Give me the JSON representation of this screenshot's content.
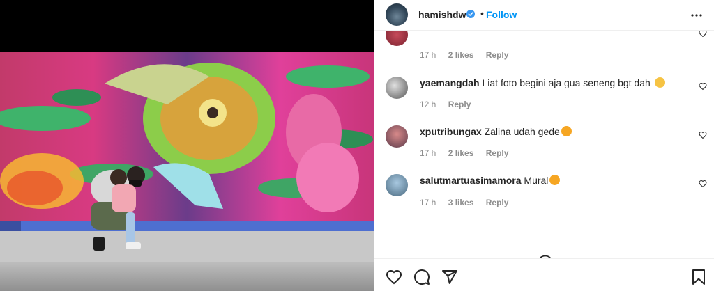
{
  "post": {
    "username": "hamishdw",
    "follow_label": "Follow",
    "separator": "•"
  },
  "comments": [
    {
      "username": "",
      "text": "",
      "time": "17 h",
      "likes": "2 likes",
      "reply": "Reply",
      "emoji_color": "#f6c343"
    },
    {
      "username": "yaemangdah",
      "text": "Liat foto begini aja gua seneng bgt dah",
      "time": "12 h",
      "likes": "",
      "reply": "Reply",
      "emoji_color": "#f6c343"
    },
    {
      "username": "xputribungax",
      "text": "Zalina udah gede",
      "time": "17 h",
      "likes": "2 likes",
      "reply": "Reply",
      "emoji_color": "#f6a623"
    },
    {
      "username": "salutmartuasimamora",
      "text": "Mural",
      "time": "17 h",
      "likes": "3 likes",
      "reply": "Reply",
      "emoji_color": "#f6a623"
    }
  ],
  "icons": {
    "verified": "verified-badge-icon",
    "more": "more-options-icon",
    "heart": "heart-icon",
    "load_more": "plus-circle-icon",
    "comment": "comment-icon",
    "share": "share-icon",
    "save": "bookmark-icon"
  },
  "colors": {
    "link": "#0095f6",
    "muted": "#8e8e8e",
    "text": "#262626"
  }
}
